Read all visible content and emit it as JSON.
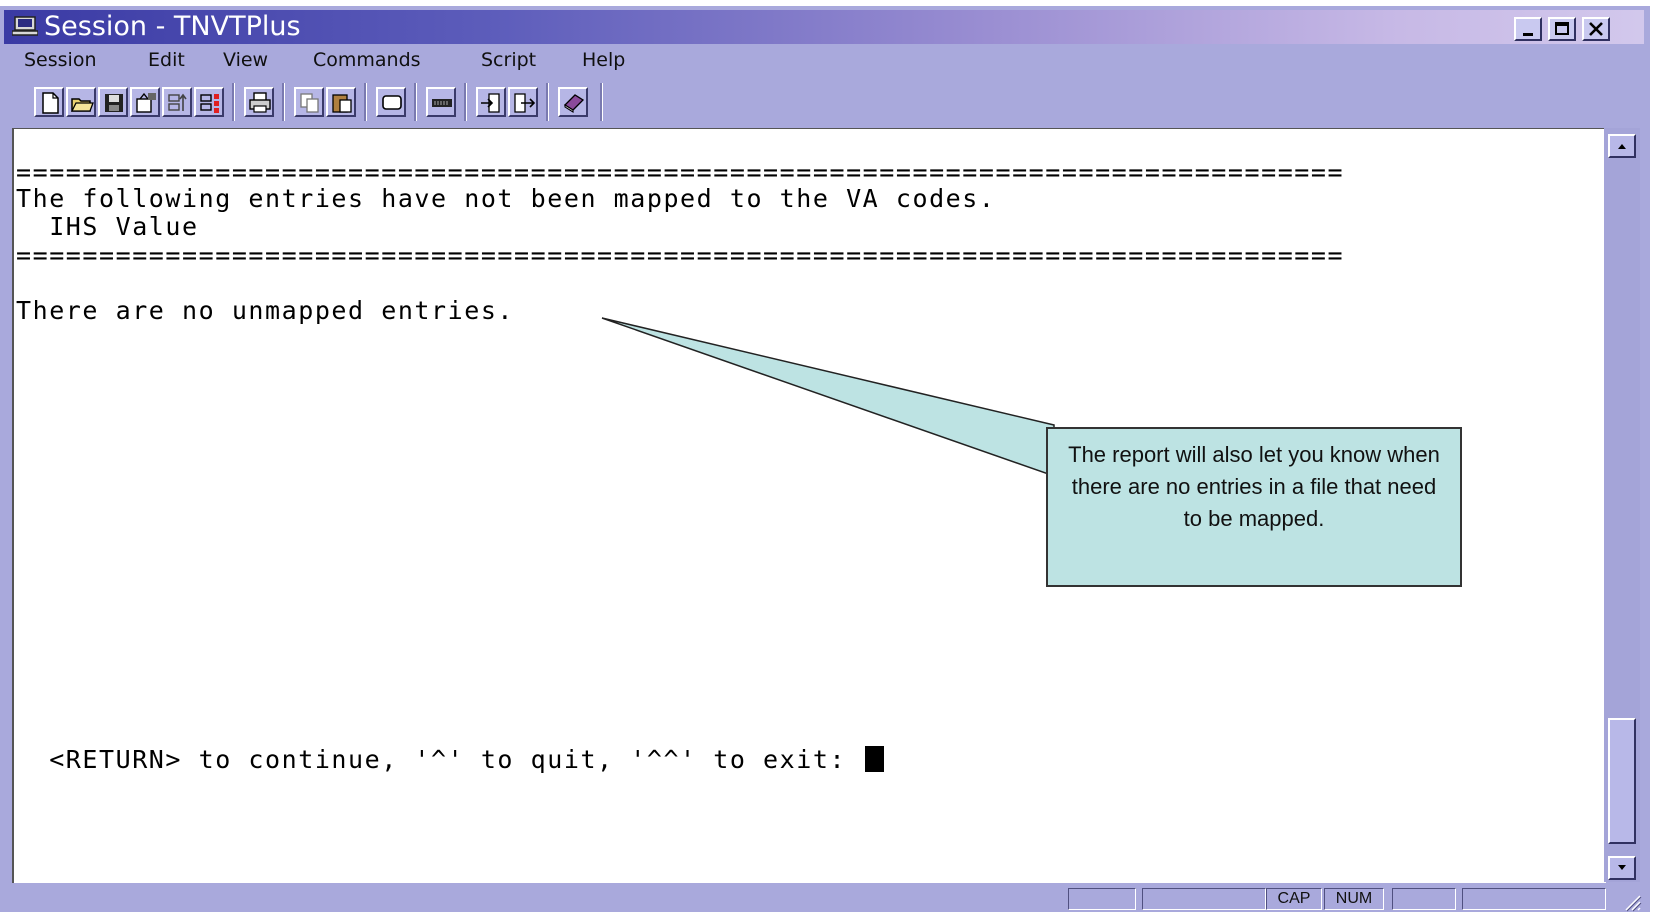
{
  "window": {
    "title": "Session - TNVTPlus",
    "controls": [
      "minimize",
      "maximize",
      "close"
    ]
  },
  "menubar": {
    "items": [
      "Session",
      "Edit",
      "View",
      "Commands",
      "Script",
      "Help"
    ]
  },
  "toolbar": {
    "buttons": [
      "new-icon",
      "open-icon",
      "save-icon",
      "properties-icon",
      "capture-icon",
      "record-icon",
      "print-icon",
      "copy-icon",
      "paste-icon",
      "screen-icon",
      "keyboard-icon",
      "send-file-icon",
      "receive-file-icon",
      "book-icon"
    ]
  },
  "terminal": {
    "lines": [
      "================================================================================",
      "The following entries have not been mapped to the VA codes.",
      "  IHS Value",
      "================================================================================",
      "There are no unmapped entries.",
      "  <RETURN> to continue, '^' to quit, '^^' to exit: "
    ]
  },
  "callout": {
    "text": "The report will also let you know when there are no entries in a file that need to be mapped.",
    "fill_color": "#bde3e3"
  },
  "statusbar": {
    "panels": [
      "",
      "",
      "CAP",
      "NUM",
      "",
      ""
    ]
  },
  "colors": {
    "frame": "#a9a9dc",
    "title_gradient_start": "#3a3aa4",
    "title_gradient_end": "#d2c8ec"
  }
}
